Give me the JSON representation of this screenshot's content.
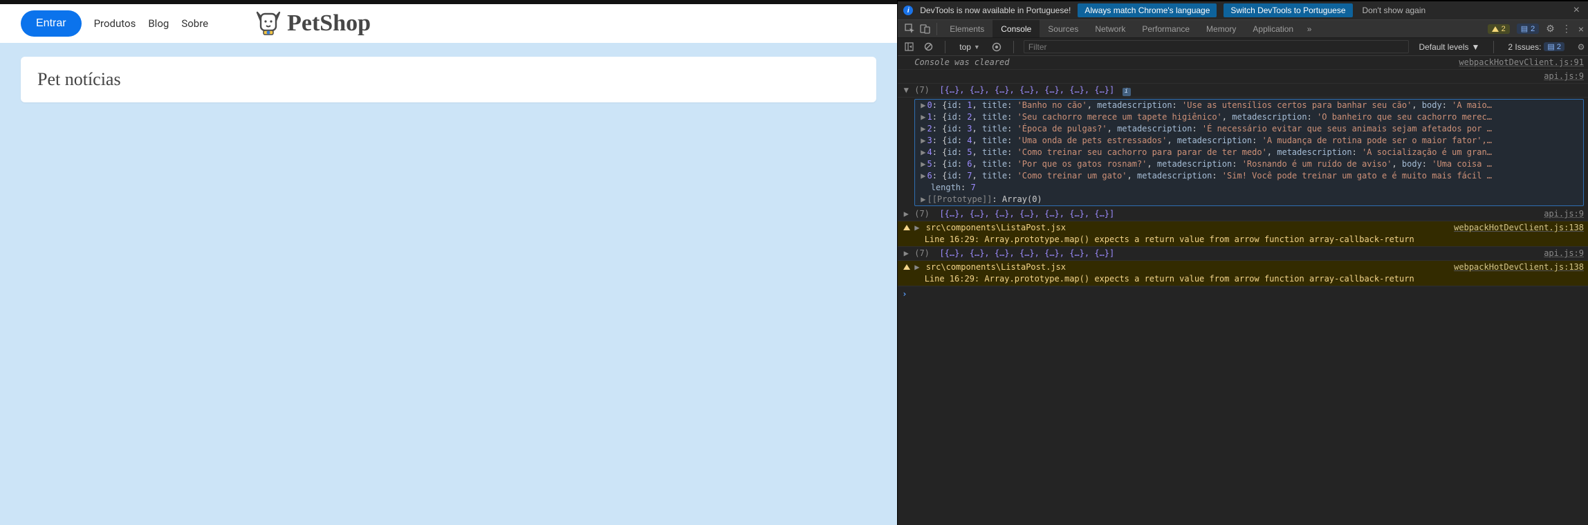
{
  "app": {
    "buttons": {
      "entrar": "Entrar"
    },
    "nav": {
      "produtos": "Produtos",
      "blog": "Blog",
      "sobre": "Sobre"
    },
    "brand": "PetShop",
    "card_title": "Pet notícias"
  },
  "infobar": {
    "text": "DevTools is now available in Portuguese!",
    "btn_match": "Always match Chrome's language",
    "btn_switch": "Switch DevTools to Portuguese",
    "btn_dont": "Don't show again"
  },
  "tabs": {
    "elements": "Elements",
    "console": "Console",
    "sources": "Sources",
    "network": "Network",
    "performance": "Performance",
    "memory": "Memory",
    "application": "Application",
    "warn_count": "2",
    "msg_count": "2"
  },
  "filterbar": {
    "context": "top",
    "placeholder": "Filter",
    "levels": "Default levels",
    "issues_label": "2 Issues:",
    "issues_count": "2"
  },
  "console": {
    "cleared_msg": "Console was cleared",
    "cleared_src": "webpackHotDevClient.js:91",
    "api_src": "api.js:9",
    "arr_header_tokens": {
      "len": "(7)",
      "preview": "[{…}, {…}, {…}, {…}, {…}, {…}, {…}]"
    },
    "entries": [
      {
        "i": "0",
        "id": "1",
        "title": "'Banho no cão'",
        "mdKey": "metadescription",
        "md": "'Use as utensílios certos para banhar seu cão'",
        "bodyKey": "body",
        "body": "'A maio…"
      },
      {
        "i": "1",
        "id": "2",
        "title": "'Seu cachorro merece um tapete higiênico'",
        "mdKey": "metadescription",
        "md": "'O banheiro que seu cachorro merec…"
      },
      {
        "i": "2",
        "id": "3",
        "title": "'Época de pulgas?'",
        "mdKey": "metadescription",
        "md": "'É necessário evitar que seus animais sejam afetados por …"
      },
      {
        "i": "3",
        "id": "4",
        "title": "'Uma onda de pets estressados'",
        "mdKey": "metadescription",
        "md": "'A mudança de rotina pode ser o maior fator',…"
      },
      {
        "i": "4",
        "id": "5",
        "title": "'Como treinar seu cachorro para parar de ter medo'",
        "mdKey": "metadescription",
        "md": "'A socialização é um gran…"
      },
      {
        "i": "5",
        "id": "6",
        "title": "'Por que os gatos rosnam?'",
        "mdKey": "metadescription",
        "md": "'Rosnando é um ruído de aviso'",
        "bodyKey": "body",
        "body": "'Uma coisa …"
      },
      {
        "i": "6",
        "id": "7",
        "title": "'Como treinar um gato'",
        "mdKey": "metadescription",
        "md": "'Sim! Você pode treinar um gato e é muito mais fácil …"
      }
    ],
    "length_label": "length",
    "length_value": "7",
    "proto_label": "[[Prototype]]",
    "proto_value": "Array(0)",
    "warn_file": "src\\components\\ListaPost.jsx",
    "warn_src": "webpackHotDevClient.js:138",
    "warn_line": "Line 16:29:  Array.prototype.map() expects a return value from arrow function  array-callback-return"
  }
}
